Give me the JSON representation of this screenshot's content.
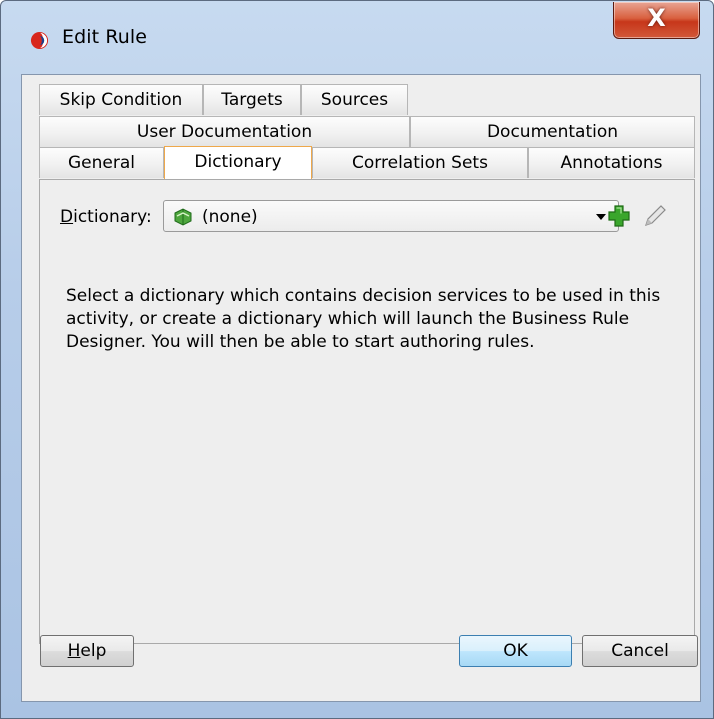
{
  "window": {
    "title": "Edit Rule",
    "close_label": "X"
  },
  "tabs": {
    "row1": [
      "Skip Condition",
      "Targets",
      "Sources"
    ],
    "row2": [
      "User Documentation",
      "Documentation"
    ],
    "row3": [
      "General",
      "Dictionary",
      "Correlation Sets",
      "Annotations"
    ],
    "selected": "Dictionary"
  },
  "dictionary": {
    "label": "Dictionary:",
    "mnemonic": "D",
    "label_rest": "ictionary:",
    "value": "(none)",
    "value_icon": "dictionary-book-icon"
  },
  "actions": {
    "add_icon": "green-plus-icon",
    "edit_icon": "pencil-icon"
  },
  "description": "Select a dictionary which contains decision services to be used in this activity, or create a dictionary which will launch the Business Rule Designer. You will then be able to start authoring rules.",
  "buttons": {
    "help": "Help",
    "help_mnemonic": "H",
    "help_rest": "elp",
    "ok": "OK",
    "cancel": "Cancel"
  },
  "colors": {
    "selected_tab_border": "#eea84b",
    "close_button": "#c7371a",
    "add_icon": "#3aa62c"
  }
}
